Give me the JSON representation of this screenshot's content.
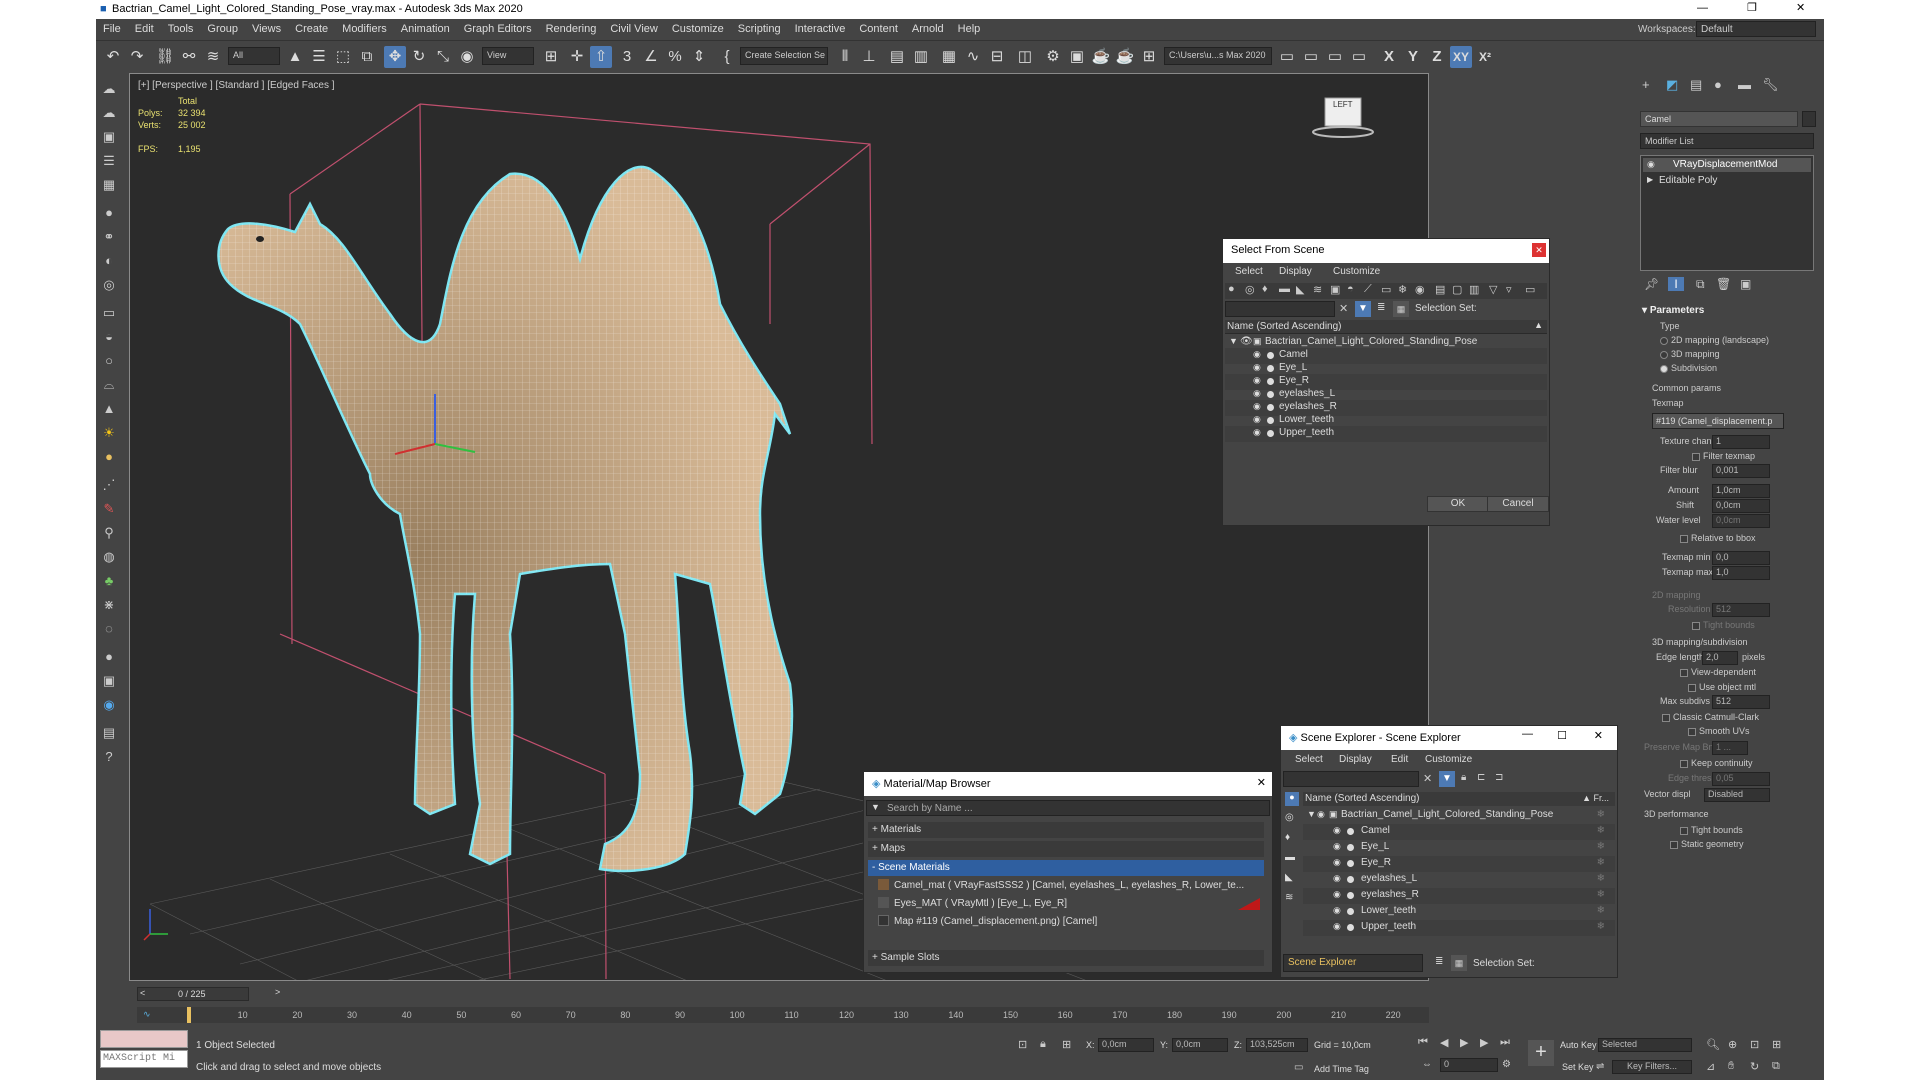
{
  "window": {
    "title": "Bactrian_Camel_Light_Colored_Standing_Pose_vray.max - Autodesk 3ds Max 2020"
  },
  "menu": [
    "File",
    "Edit",
    "Tools",
    "Group",
    "Views",
    "Create",
    "Modifiers",
    "Animation",
    "Graph Editors",
    "Rendering",
    "Civil View",
    "Customize",
    "Scripting",
    "Interactive",
    "Content",
    "Arnold",
    "Help"
  ],
  "workspace": {
    "label": "Workspaces:",
    "value": "Default"
  },
  "toolbar": {
    "filter": "All",
    "view": "View",
    "selset": "Create Selection Se",
    "path": "C:\\Users\\u...s Max 2020",
    "axes": [
      "X",
      "Y",
      "Z",
      "XY",
      "X²"
    ]
  },
  "viewport": {
    "label": "[+] [Perspective ] [Standard ] [Edged Faces ]",
    "stats": {
      "total": "Total",
      "polys_label": "Polys:",
      "polys": "32 394",
      "verts_label": "Verts:",
      "verts": "25 002",
      "fps_label": "FPS:",
      "fps": "1,195"
    },
    "viewcube": "LEFT"
  },
  "select_from_scene": {
    "title": "Select From Scene",
    "menu": [
      "Select",
      "Display",
      "Customize"
    ],
    "selection_set": "Selection Set:",
    "header": "Name (Sorted Ascending)",
    "root": "Bactrian_Camel_Light_Colored_Standing_Pose",
    "items": [
      "Camel",
      "Eye_L",
      "Eye_R",
      "eyelashes_L",
      "eyelashes_R",
      "Lower_teeth",
      "Upper_teeth"
    ],
    "ok": "OK",
    "cancel": "Cancel"
  },
  "material_browser": {
    "title": "Material/Map Browser",
    "search": "Search by Name ...",
    "sections": [
      "+ Materials",
      "+ Maps",
      "- Scene Materials",
      "+ Sample Slots"
    ],
    "scene_materials": [
      "Camel_mat ( VRayFastSSS2 ) [Camel, eyelashes_L, eyelashes_R, Lower_te...",
      "Eyes_MAT ( VRayMtl ) [Eye_L, Eye_R]",
      "Map #119 (Camel_displacement.png) [Camel]"
    ]
  },
  "scene_explorer": {
    "title": "Scene Explorer - Scene Explorer",
    "menu": [
      "Select",
      "Display",
      "Edit",
      "Customize"
    ],
    "header": "Name (Sorted Ascending)",
    "header2": "▲ Fr...",
    "root": "Bactrian_Camel_Light_Colored_Standing_Pose",
    "items": [
      "Camel",
      "Eye_L",
      "Eye_R",
      "eyelashes_L",
      "eyelashes_R",
      "Lower_teeth",
      "Upper_teeth"
    ],
    "footer_combo": "Scene Explorer",
    "selection_set": "Selection Set:"
  },
  "command_panel": {
    "object_name": "Camel",
    "modifier_list": "Modifier List",
    "stack": [
      "VRayDisplacementMod",
      "Editable Poly"
    ],
    "parameters": "Parameters",
    "type_label": "Type",
    "types": [
      "2D mapping (landscape)",
      "3D mapping",
      "Subdivision"
    ],
    "common_params": "Common params",
    "texmap_label": "Texmap",
    "texmap": "#119 (Camel_displacement.p",
    "texture_chan_label": "Texture chan",
    "texture_chan": "1",
    "filter_texmap": "Filter texmap",
    "filter_blur_label": "Filter blur",
    "filter_blur": "0,001",
    "amount_label": "Amount",
    "amount": "1,0cm",
    "shift_label": "Shift",
    "shift": "0,0cm",
    "water_label": "Water level",
    "water": "0,0cm",
    "relative_bbox": "Relative to bbox",
    "texmap_min_label": "Texmap min",
    "texmap_min": "0,0",
    "texmap_max_label": "Texmap max",
    "texmap_max": "1,0",
    "mapping2d": "2D mapping",
    "resolution_label": "Resolution",
    "resolution": "512",
    "tight_bounds": "Tight bounds",
    "mapping3d": "3D mapping/subdivision",
    "edge_length_label": "Edge length",
    "edge_length": "2,0",
    "pixels": "pixels",
    "view_dependent": "View-dependent",
    "use_object_mtl": "Use object mtl",
    "max_subdivs_label": "Max subdivs",
    "max_subdivs": "512",
    "catmull": "Classic Catmull-Clark",
    "smooth_uvs": "Smooth UVs",
    "preserve_label": "Preserve Map Bnd",
    "preserve": "1 ...",
    "keep_continuity": "Keep continuity",
    "edge_thresh_label": "Edge thresh",
    "edge_thresh": "0,05",
    "vector_label": "Vector displ",
    "vector": "Disabled",
    "perf": "3D performance",
    "tight_bounds2": "Tight bounds",
    "static_geometry": "Static geometry"
  },
  "timeline": {
    "frame": "0 / 225",
    "ticks": [
      "10",
      "20",
      "30",
      "40",
      "50",
      "60",
      "70",
      "80",
      "90",
      "100",
      "110",
      "120",
      "130",
      "140",
      "150",
      "160",
      "170",
      "180",
      "190",
      "200",
      "210",
      "220"
    ]
  },
  "status": {
    "maxscript": "MAXScript Mi",
    "selected": "1 Object Selected",
    "prompt": "Click and drag to select and move objects",
    "x_label": "X:",
    "x": "0,0cm",
    "y_label": "Y:",
    "y": "0,0cm",
    "z_label": "Z:",
    "z": "103,525cm",
    "grid": "Grid = 10,0cm",
    "add_time_tag": "Add Time Tag",
    "auto_key": "Auto Key",
    "set_key": "Set Key",
    "selected_combo": "Selected",
    "key_filters": "Key Filters...",
    "frame_value": "0"
  },
  "colors": {
    "accent": "#4d7ab4",
    "camel": "#d9bb98",
    "outline": "#7ee6f2",
    "bbox": "#c0506e"
  }
}
